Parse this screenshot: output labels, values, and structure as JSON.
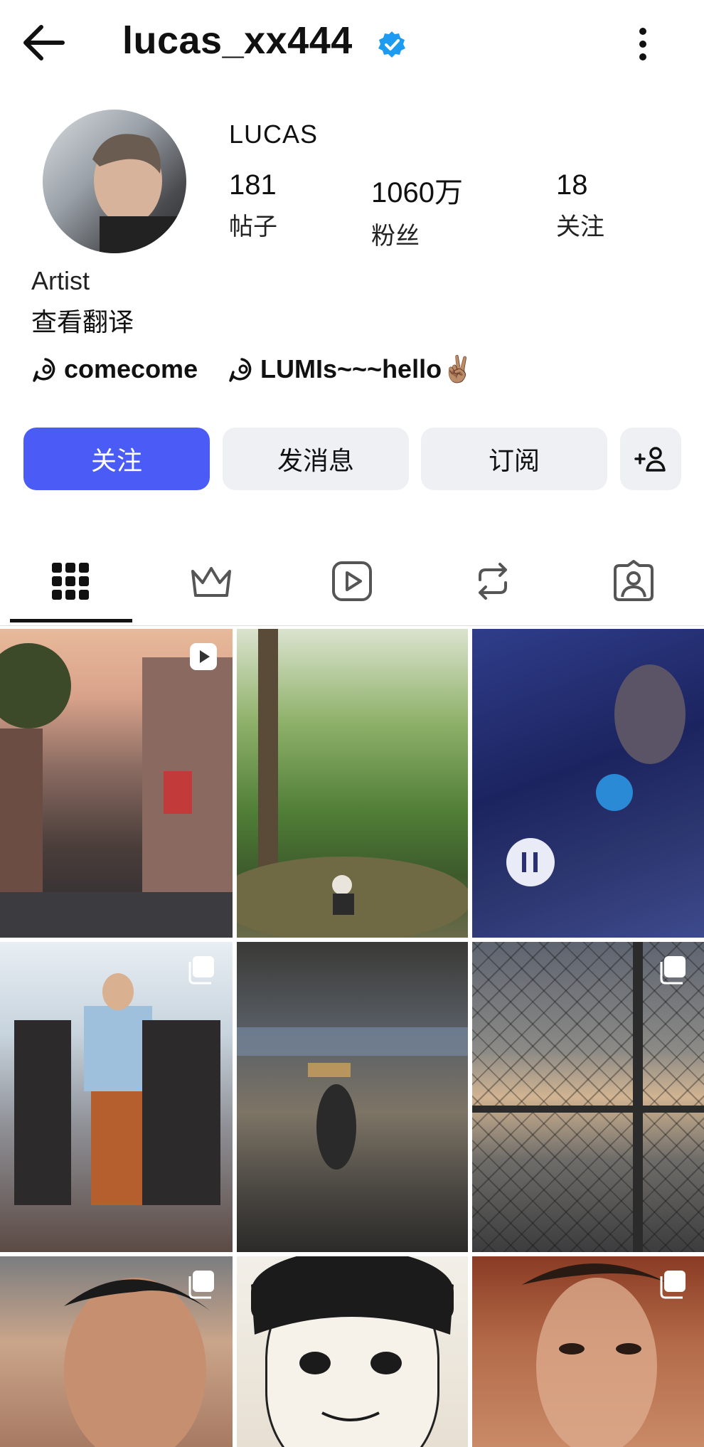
{
  "header": {
    "handle": "lucas_xx444"
  },
  "profile": {
    "display_name": "LUCAS",
    "stats": [
      {
        "num": "181",
        "label": "帖子"
      },
      {
        "num": "1060万",
        "label": "粉丝"
      },
      {
        "num": "18",
        "label": "关注"
      }
    ],
    "bio": "Artist",
    "translate": "查看翻译",
    "threads_links": [
      "comecome",
      "LUMIs~~~hello✌🏽"
    ]
  },
  "buttons": {
    "follow": "关注",
    "message": "发消息",
    "subscribe": "订阅"
  },
  "colors": {
    "accent": "#4a5cf5",
    "verified": "#1d9bf0",
    "secondary_button": "#eff0f4"
  },
  "tabs": [
    {
      "icon": "grid-icon",
      "active": true
    },
    {
      "icon": "crown-icon",
      "active": false
    },
    {
      "icon": "reels-icon",
      "active": false
    },
    {
      "icon": "reposts-icon",
      "active": false
    },
    {
      "icon": "tagged-icon",
      "active": false
    }
  ],
  "grid_posts": [
    {
      "type": "reel",
      "icon": "reel-badge-icon"
    },
    {
      "type": "photo"
    },
    {
      "type": "photo"
    },
    {
      "type": "carousel",
      "icon": "carousel-badge-icon"
    },
    {
      "type": "photo"
    },
    {
      "type": "carousel",
      "icon": "carousel-badge-icon"
    },
    {
      "type": "carousel",
      "icon": "carousel-badge-icon"
    },
    {
      "type": "photo"
    },
    {
      "type": "carousel",
      "icon": "carousel-badge-icon"
    }
  ]
}
